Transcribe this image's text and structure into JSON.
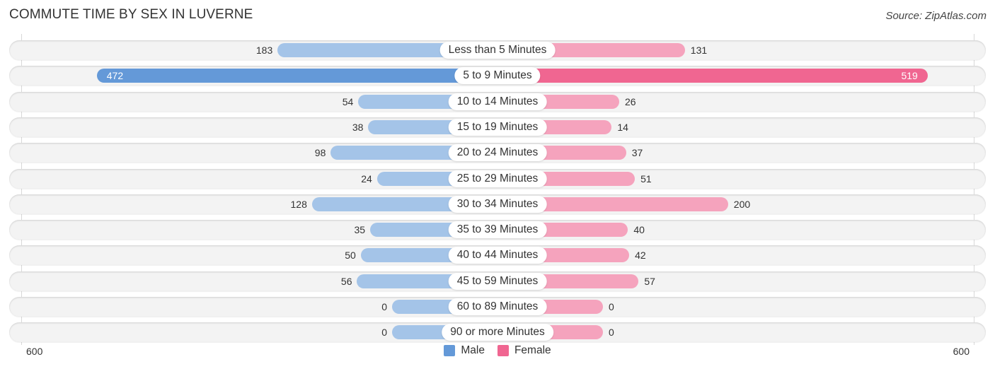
{
  "header": {
    "title": "COMMUTE TIME BY SEX IN LUVERNE",
    "source": "Source: ZipAtlas.com"
  },
  "colors": {
    "male": "#a4c4e8",
    "male_strong": "#6499d8",
    "female": "#f5a3bd",
    "female_strong": "#f06691"
  },
  "chart_data": {
    "type": "bar",
    "orientation": "horizontal-diverging",
    "title": "COMMUTE TIME BY SEX IN LUVERNE",
    "categories": [
      "Less than 5 Minutes",
      "5 to 9 Minutes",
      "10 to 14 Minutes",
      "15 to 19 Minutes",
      "20 to 24 Minutes",
      "25 to 29 Minutes",
      "30 to 34 Minutes",
      "35 to 39 Minutes",
      "40 to 44 Minutes",
      "45 to 59 Minutes",
      "60 to 89 Minutes",
      "90 or more Minutes"
    ],
    "series": [
      {
        "name": "Male",
        "values": [
          183,
          472,
          54,
          38,
          98,
          24,
          128,
          35,
          50,
          56,
          0,
          0
        ]
      },
      {
        "name": "Female",
        "values": [
          131,
          519,
          26,
          14,
          37,
          51,
          200,
          40,
          42,
          57,
          0,
          0
        ]
      }
    ],
    "axis": {
      "left_label": "600",
      "right_label": "600",
      "range": [
        0,
        600
      ]
    },
    "legend": {
      "position": "bottom-center",
      "entries": [
        "Male",
        "Female"
      ]
    },
    "xlabel": "",
    "ylabel": ""
  }
}
